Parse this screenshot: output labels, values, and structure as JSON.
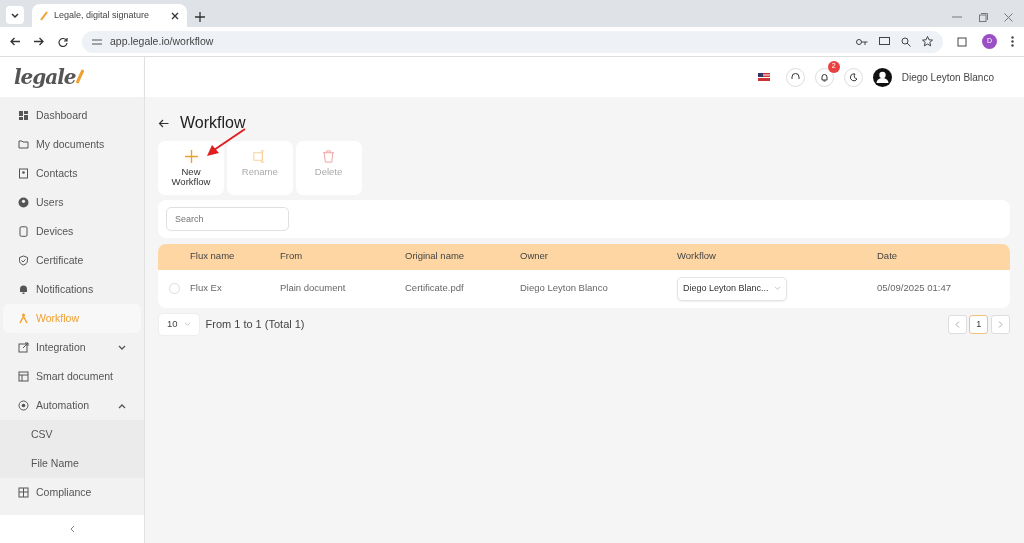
{
  "browser": {
    "tab_title": "Legale, digital signature",
    "url": "app.legale.io/workflow",
    "profile_initial": "D"
  },
  "header": {
    "logo_text": "legale",
    "notification_count": "2",
    "user_name": "Diego Leyton Blanco"
  },
  "sidebar": {
    "items": [
      {
        "label": "Dashboard",
        "selected": false
      },
      {
        "label": "My documents",
        "selected": false
      },
      {
        "label": "Contacts",
        "selected": false
      },
      {
        "label": "Users",
        "selected": false
      },
      {
        "label": "Devices",
        "selected": false
      },
      {
        "label": "Certificate",
        "selected": false
      },
      {
        "label": "Notifications",
        "selected": false
      },
      {
        "label": "Workflow",
        "selected": true
      },
      {
        "label": "Integration",
        "selected": false,
        "expanded": false
      },
      {
        "label": "Smart document",
        "selected": false
      },
      {
        "label": "Automation",
        "selected": false,
        "expanded": true,
        "children": [
          {
            "label": "CSV",
            "selected": false
          },
          {
            "label": "File Name",
            "selected": false
          }
        ]
      },
      {
        "label": "Compliance",
        "selected": false
      }
    ]
  },
  "page": {
    "title": "Workflow"
  },
  "toolbar": [
    {
      "label": "New Workflow",
      "disabled": false
    },
    {
      "label": "Rename",
      "disabled": true
    },
    {
      "label": "Delete",
      "disabled": true
    }
  ],
  "search": {
    "placeholder": "Search"
  },
  "table": {
    "columns": [
      "Flux name",
      "From",
      "Original name",
      "Owner",
      "Workflow",
      "Date"
    ],
    "rows": [
      {
        "checked": false,
        "cells": [
          "Flux Ex",
          "Plain document",
          "Certificate.pdf",
          "Diego Leyton Blanco",
          "Diego Leyton Blanc...",
          "05/09/2025 01:47"
        ]
      }
    ]
  },
  "footer": {
    "page_size": "10",
    "summary": "From 1 to 1 (Total 1)",
    "pages": [
      {
        "label": "1",
        "selected": true
      }
    ]
  },
  "annotation": {
    "kind": "arrow"
  }
}
